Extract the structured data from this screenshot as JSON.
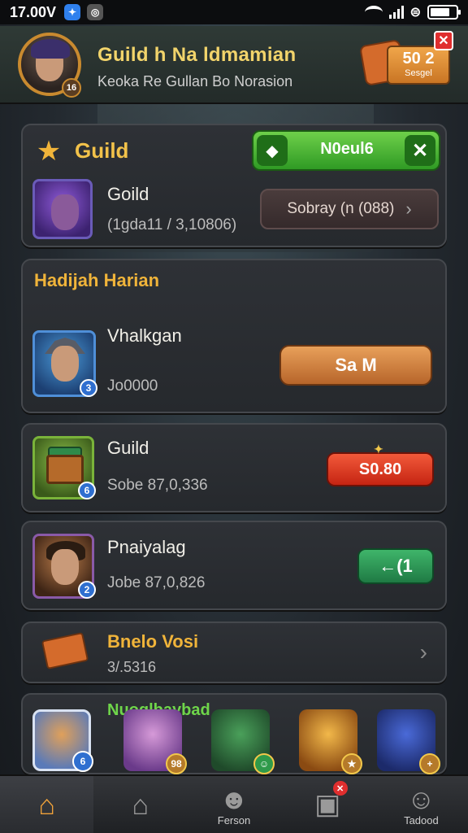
{
  "status_bar": {
    "time": "17.00V",
    "icons": [
      "messenger-icon",
      "settings-app-icon",
      "wifi-icon",
      "signal-icon",
      "vibrate-icon",
      "battery-icon"
    ]
  },
  "header": {
    "title": "Guild h Na ldmamian",
    "subtitle": "Keoka Re Gullan Bo Norasion",
    "level_badge": "16",
    "reward_value": "50 2",
    "reward_sub": "Sesgel",
    "close_label": "✕"
  },
  "guild_panel": {
    "title": "Guild",
    "action_label": "N0eul6",
    "member_name": "Goild",
    "member_sub": "(1gda11 / 3,10806)",
    "summary_button": "Sobray (n (088)"
  },
  "hadiah_panel": {
    "title": "Hadijah Harian",
    "item_name": "Vhalkgan",
    "item_sub": "Jo0000",
    "item_badge": "3",
    "button_label": "Sa M"
  },
  "guild_reward": {
    "name": "Guild",
    "sub": "Sobe 87,0,336",
    "badge": "6",
    "button_label": "S0.80"
  },
  "pna_reward": {
    "name": "Pnaiyalag",
    "sub": "Jobe 87,0,826",
    "badge": "2",
    "button_label": "←(1"
  },
  "bnelo": {
    "title": "Bnelo Vosi",
    "sub": "3/.5316"
  },
  "character_row": {
    "title": "Nuoglbaybad",
    "badges": [
      "6",
      "98",
      "",
      "",
      "+"
    ]
  },
  "bottom_nav": [
    {
      "label": "",
      "icon": "home-icon"
    },
    {
      "label": "",
      "icon": "castle-icon"
    },
    {
      "label": "Ferson",
      "icon": "person-icon"
    },
    {
      "label": "",
      "icon": "chat-icon",
      "alert": "✕"
    },
    {
      "label": "Tadood",
      "icon": "face-icon"
    }
  ]
}
